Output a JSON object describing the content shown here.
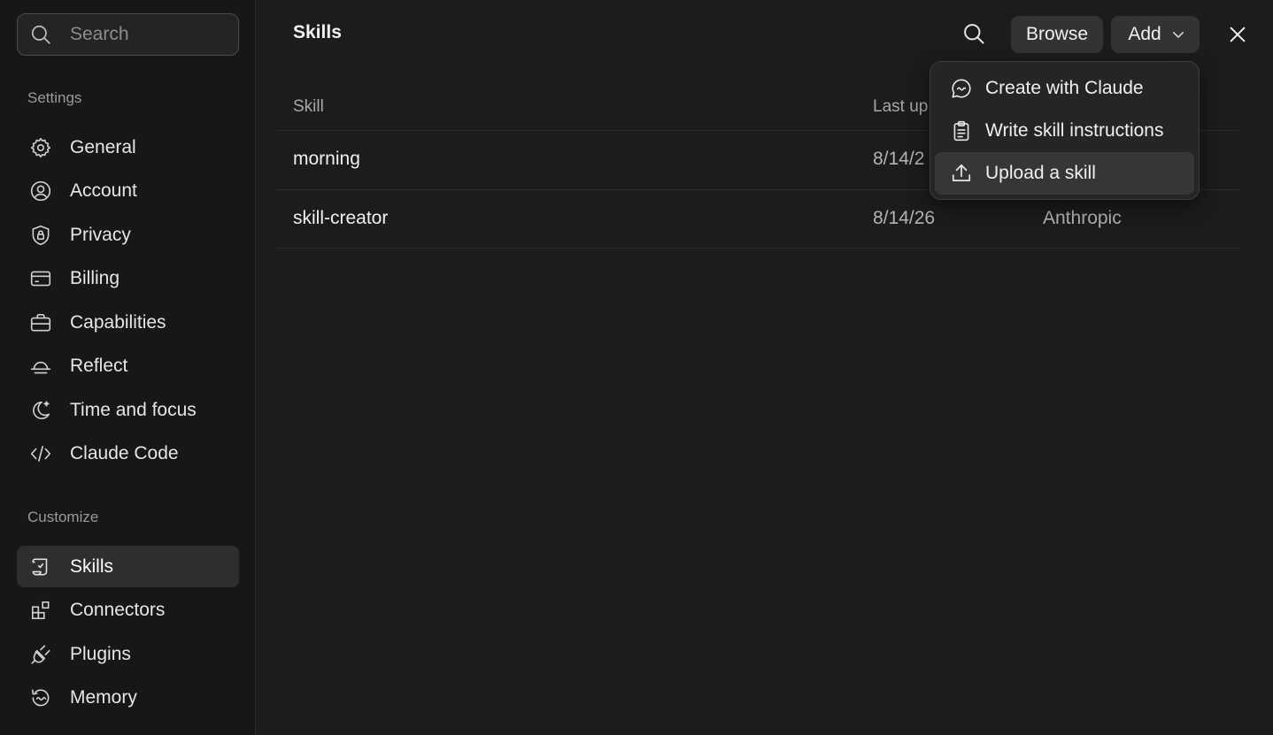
{
  "sidebar": {
    "search": {
      "placeholder": "Search"
    },
    "settings_label": "Settings",
    "settings_items": [
      {
        "label": "General",
        "icon": "gear-icon"
      },
      {
        "label": "Account",
        "icon": "user-circle-icon"
      },
      {
        "label": "Privacy",
        "icon": "shield-lock-icon"
      },
      {
        "label": "Billing",
        "icon": "credit-card-icon"
      },
      {
        "label": "Capabilities",
        "icon": "briefcase-icon"
      },
      {
        "label": "Reflect",
        "icon": "sunrise-icon"
      },
      {
        "label": "Time and focus",
        "icon": "moon-star-icon"
      },
      {
        "label": "Claude Code",
        "icon": "code-icon"
      }
    ],
    "customize_label": "Customize",
    "customize_items": [
      {
        "label": "Skills",
        "icon": "scroll-icon",
        "active": true
      },
      {
        "label": "Connectors",
        "icon": "blocks-icon"
      },
      {
        "label": "Plugins",
        "icon": "plug-icon"
      },
      {
        "label": "Memory",
        "icon": "history-icon"
      }
    ]
  },
  "main": {
    "title": "Skills",
    "toolbar": {
      "search_icon": "search-icon",
      "browse_label": "Browse",
      "add_label": "Add",
      "close_icon": "close-icon"
    },
    "table": {
      "headers": {
        "skill": "Skill",
        "last_updated": "Last up"
      },
      "rows": [
        {
          "name": "morning",
          "date": "8/14/2",
          "author": ""
        },
        {
          "name": "skill-creator",
          "date": "8/14/26",
          "author": "Anthropic"
        }
      ]
    },
    "add_menu": {
      "items": [
        {
          "label": "Create with Claude",
          "icon": "chat-bubble-icon"
        },
        {
          "label": "Write skill instructions",
          "icon": "clipboard-icon"
        },
        {
          "label": "Upload a skill",
          "icon": "upload-icon",
          "hovered": true
        }
      ]
    }
  },
  "colors": {
    "background": "#1c1c1c",
    "sidebar": "#171717",
    "active_item": "#2e2e2e",
    "button": "#333333",
    "dropdown": "#252525"
  }
}
